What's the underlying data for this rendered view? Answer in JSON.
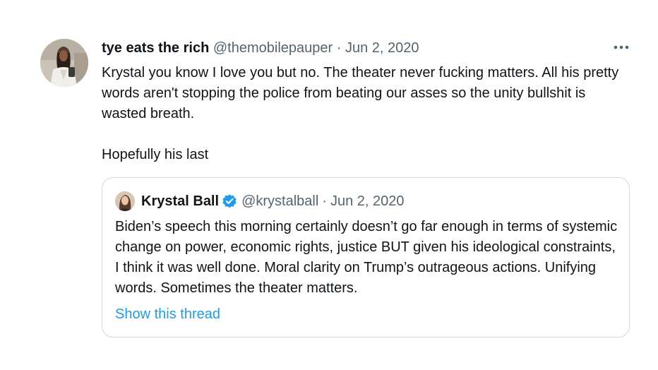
{
  "tweet": {
    "author_name": "tye eats the rich",
    "author_handle": "@themobilepauper",
    "separator": "·",
    "date": "Jun 2, 2020",
    "more_icon": "more-horizontal-icon",
    "paragraphs": [
      "Krystal you know I love you but no. The theater never fucking matters. All his pretty words aren't stopping the police from beating our asses so the unity bullshit is wasted breath.",
      "Hopefully his last"
    ]
  },
  "quoted_tweet": {
    "author_name": "Krystal Ball",
    "verified_icon": "verified-badge-icon",
    "author_handle": "@krystalball",
    "separator": "·",
    "date": "Jun 2, 2020",
    "text": "Biden’s speech this morning certainly doesn’t go far enough in terms of systemic change on power, economic rights, justice BUT given his ideological constraints, I think it was well done. Moral clarity on Trump’s outrageous actions. Unifying words. Sometimes the theater matters.",
    "show_thread_label": "Show this thread"
  },
  "colors": {
    "text_primary": "#0f1419",
    "text_secondary": "#536471",
    "link": "#1d9bf0",
    "border": "#cfd9de",
    "verified": "#1d9bf0"
  }
}
